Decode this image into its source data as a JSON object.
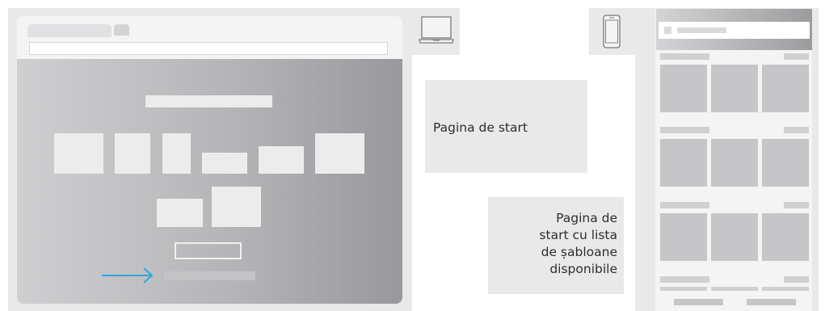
{
  "callouts": {
    "start_page": "Pagina de start",
    "templates_page": {
      "line1": "Pagina de",
      "line2": "start cu lista",
      "line3": "de șabloane",
      "line4": "disponibile"
    }
  },
  "icons": {
    "desktop": "laptop-icon",
    "mobile": "smartphone-icon"
  },
  "colors": {
    "arrow": "#2fa6e0",
    "gradient_light": "#cfcfd1",
    "gradient_dark": "#98999c"
  }
}
